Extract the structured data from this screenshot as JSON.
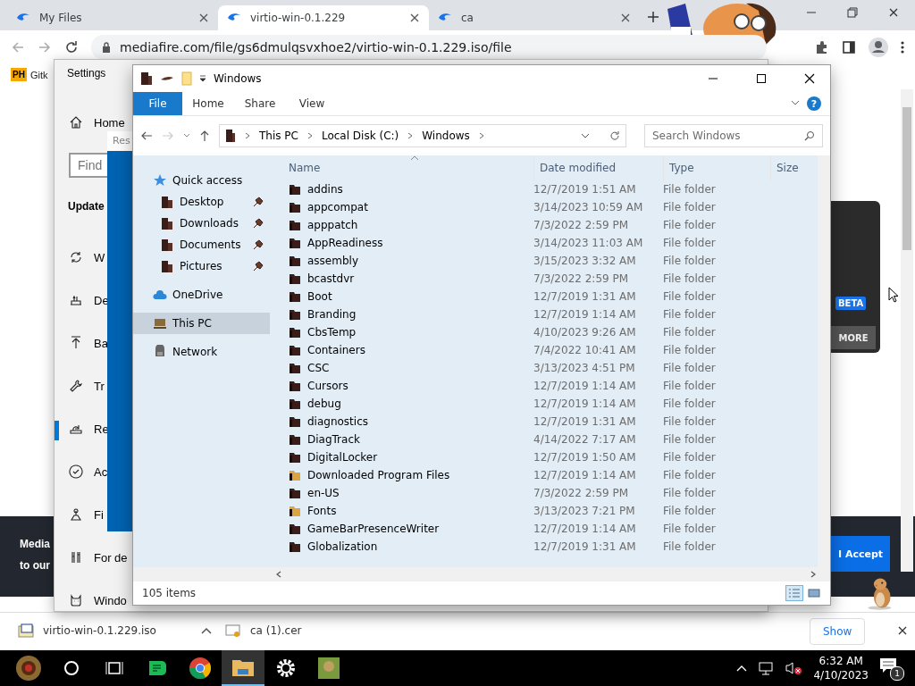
{
  "browser": {
    "tabs": [
      {
        "title": "My Files",
        "selected": false
      },
      {
        "title": "virtio-win-0.1.229",
        "selected": true
      },
      {
        "title": "ca",
        "selected": false
      }
    ],
    "url": "mediafire.com/file/gs6dmulqsvxhoe2/virtio-win-0.1.229.iso/file",
    "bookmarks": [
      {
        "badge": "PH",
        "label": "Gitk"
      }
    ]
  },
  "page": {
    "card_badge": "BETA",
    "card_button": "MORE",
    "banner_lines": [
      "Media",
      "to our"
    ],
    "accept_button": "I Accept"
  },
  "downloads": {
    "items": [
      {
        "name": "virtio-win-0.1.229.iso",
        "kind": "iso"
      },
      {
        "name": "ca (1).cer",
        "kind": "cert"
      }
    ],
    "show_button": "Show"
  },
  "settings": {
    "title": "Settings",
    "home": "Home",
    "search_placeholder": "Find",
    "section": "Update",
    "items": [
      {
        "label": "W",
        "kind": "sync",
        "selected": false
      },
      {
        "label": "De",
        "kind": "delivery",
        "selected": false
      },
      {
        "label": "Ba",
        "kind": "backup",
        "selected": false
      },
      {
        "label": "Tr",
        "kind": "wrench",
        "selected": false
      },
      {
        "label": "Re",
        "kind": "recovery",
        "selected": true
      },
      {
        "label": "Ac",
        "kind": "check",
        "selected": false
      },
      {
        "label": "Fi",
        "kind": "find",
        "selected": false
      },
      {
        "label": "For de",
        "kind": "tools",
        "selected": false
      },
      {
        "label": "Windo",
        "kind": "cat",
        "selected": false
      }
    ]
  },
  "reset_dialog": {
    "title": "Res"
  },
  "explorer": {
    "title": "Windows",
    "ribbon_tabs": [
      {
        "label": "File",
        "selected": true
      },
      {
        "label": "Home",
        "selected": false
      },
      {
        "label": "Share",
        "selected": false
      },
      {
        "label": "View",
        "selected": false
      }
    ],
    "help": "?",
    "breadcrumb": [
      "This PC",
      "Local Disk (C:)",
      "Windows"
    ],
    "search_placeholder": "Search Windows",
    "nav": [
      {
        "label": "Quick access",
        "kind": "star",
        "selected": false,
        "children": [
          {
            "label": "Desktop",
            "kind": "folder",
            "selected": false,
            "pinned": true
          },
          {
            "label": "Downloads",
            "kind": "folder",
            "selected": false,
            "pinned": true
          },
          {
            "label": "Documents",
            "kind": "folder",
            "selected": false,
            "pinned": true
          },
          {
            "label": "Pictures",
            "kind": "folder",
            "selected": false,
            "pinned": true
          }
        ]
      },
      {
        "label": "OneDrive",
        "kind": "cloud",
        "selected": false
      },
      {
        "label": "This PC",
        "kind": "pc",
        "selected": true
      },
      {
        "label": "Network",
        "kind": "network",
        "selected": false
      }
    ],
    "columns": [
      "Name",
      "Date modified",
      "Type",
      "Size"
    ],
    "rows": [
      {
        "name": "addins",
        "date": "12/7/2019 1:51 AM",
        "type": "File folder",
        "kind": "plain"
      },
      {
        "name": "appcompat",
        "date": "3/14/2023 10:59 AM",
        "type": "File folder",
        "kind": "plain"
      },
      {
        "name": "apppatch",
        "date": "7/3/2022 2:59 PM",
        "type": "File folder",
        "kind": "plain"
      },
      {
        "name": "AppReadiness",
        "date": "3/14/2023 11:03 AM",
        "type": "File folder",
        "kind": "plain"
      },
      {
        "name": "assembly",
        "date": "3/15/2023 3:32 AM",
        "type": "File folder",
        "kind": "plain"
      },
      {
        "name": "bcastdvr",
        "date": "7/3/2022 2:59 PM",
        "type": "File folder",
        "kind": "plain"
      },
      {
        "name": "Boot",
        "date": "12/7/2019 1:31 AM",
        "type": "File folder",
        "kind": "plain"
      },
      {
        "name": "Branding",
        "date": "12/7/2019 1:14 AM",
        "type": "File folder",
        "kind": "plain"
      },
      {
        "name": "CbsTemp",
        "date": "4/10/2023 9:26 AM",
        "type": "File folder",
        "kind": "plain"
      },
      {
        "name": "Containers",
        "date": "7/4/2022 10:41 AM",
        "type": "File folder",
        "kind": "plain"
      },
      {
        "name": "CSC",
        "date": "3/13/2023 4:51 PM",
        "type": "File folder",
        "kind": "plain"
      },
      {
        "name": "Cursors",
        "date": "12/7/2019 1:14 AM",
        "type": "File folder",
        "kind": "plain"
      },
      {
        "name": "debug",
        "date": "12/7/2019 1:14 AM",
        "type": "File folder",
        "kind": "plain"
      },
      {
        "name": "diagnostics",
        "date": "12/7/2019 1:31 AM",
        "type": "File folder",
        "kind": "plain"
      },
      {
        "name": "DiagTrack",
        "date": "4/14/2022 7:17 AM",
        "type": "File folder",
        "kind": "plain"
      },
      {
        "name": "DigitalLocker",
        "date": "12/7/2019 1:50 AM",
        "type": "File folder",
        "kind": "plain"
      },
      {
        "name": "Downloaded Program Files",
        "date": "12/7/2019 1:14 AM",
        "type": "File folder",
        "kind": "special"
      },
      {
        "name": "en-US",
        "date": "7/3/2022 2:59 PM",
        "type": "File folder",
        "kind": "plain"
      },
      {
        "name": "Fonts",
        "date": "3/13/2023 7:21 PM",
        "type": "File folder",
        "kind": "special"
      },
      {
        "name": "GameBarPresenceWriter",
        "date": "12/7/2019 1:14 AM",
        "type": "File folder",
        "kind": "plain"
      },
      {
        "name": "Globalization",
        "date": "12/7/2019 1:31 AM",
        "type": "File folder",
        "kind": "plain"
      }
    ],
    "status": "105 items",
    "views": [
      {
        "kind": "details",
        "selected": true
      },
      {
        "kind": "tiles",
        "selected": false
      }
    ]
  },
  "taskbar": {
    "apps": [
      {
        "kind": "start",
        "active": false
      },
      {
        "kind": "search",
        "active": false
      },
      {
        "kind": "taskview",
        "active": false
      },
      {
        "kind": "notes",
        "active": false
      },
      {
        "kind": "chrome",
        "active": false
      },
      {
        "kind": "explorer",
        "active": true
      },
      {
        "kind": "settings",
        "active": false
      },
      {
        "kind": "sandbox",
        "active": false
      }
    ],
    "time": "6:32 AM",
    "date": "4/10/2023",
    "notifications": "1"
  }
}
